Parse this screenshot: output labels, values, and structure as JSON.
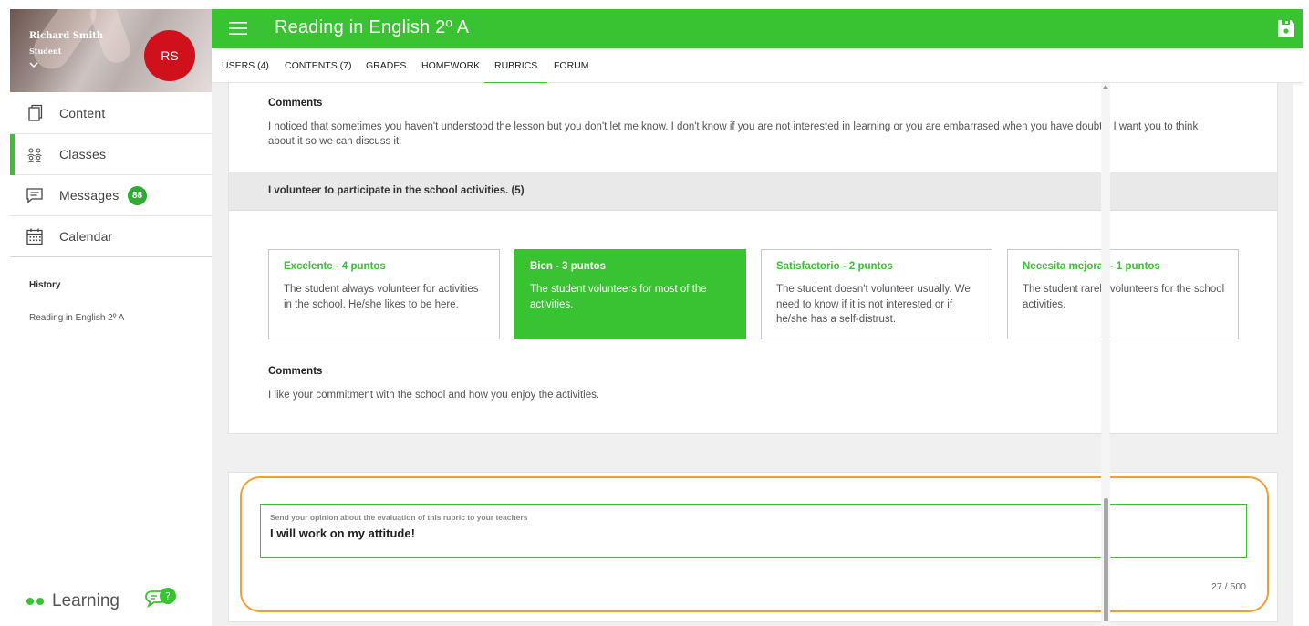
{
  "user": {
    "name": "Richard Smith",
    "role": "Student",
    "initials": "RS"
  },
  "sidebar": {
    "items": [
      {
        "label": "Content",
        "icon": "content-icon"
      },
      {
        "label": "Classes",
        "icon": "classes-icon",
        "active": true
      },
      {
        "label": "Messages",
        "icon": "messages-icon",
        "badge": "88"
      },
      {
        "label": "Calendar",
        "icon": "calendar-icon"
      }
    ],
    "history_title": "History",
    "history_items": [
      "Reading in English 2º A"
    ],
    "logo_text": "Learning"
  },
  "header": {
    "title": "Reading in English 2º A"
  },
  "tabs": [
    "USERS (4)",
    "CONTENTS (7)",
    "GRADES",
    "HOMEWORK",
    "RUBRICS",
    "FORUM"
  ],
  "active_tab": "RUBRICS",
  "rubric": {
    "previous_comment": {
      "label": "Comments",
      "text_line1": "I noticed that sometimes you haven't understood the lesson but you don't let me know. I don't know if you are not interested in learning or you are embarrased when you have doubts.  I want you to think",
      "text_line2": "about it so we can discuss it."
    },
    "criterion": {
      "title": "I volunteer to participate in the school activities. (5)",
      "levels": [
        {
          "title": "Excelente - 4 puntos",
          "description": "The student always volunteer for activities in the school. He/she likes to be here.",
          "selected": false
        },
        {
          "title": "Bien - 3 puntos",
          "description": "The student volunteers for most of the activities.",
          "selected": true
        },
        {
          "title": "Satisfactorio - 2 puntos",
          "description": "The student doesn't volunteer usually. We need to know if it is not interested or if he/she has a self-distrust.",
          "selected": false
        },
        {
          "title": "Necesita mejorar - 1 puntos",
          "description": "The student rarely volunteers for the school activities.",
          "selected": false
        }
      ],
      "comment_label": "Comments",
      "comment_text": "I like your commitment with the school and how you enjoy the activities."
    }
  },
  "opinion": {
    "placeholder": "Send your opinion about the evaluation of this rubric to your teachers",
    "value": "I will work on my attitude!",
    "counter": "27 / 500"
  },
  "colors": {
    "accent": "#39c232",
    "avatar": "#d0101a",
    "highlight": "#f0a030"
  }
}
